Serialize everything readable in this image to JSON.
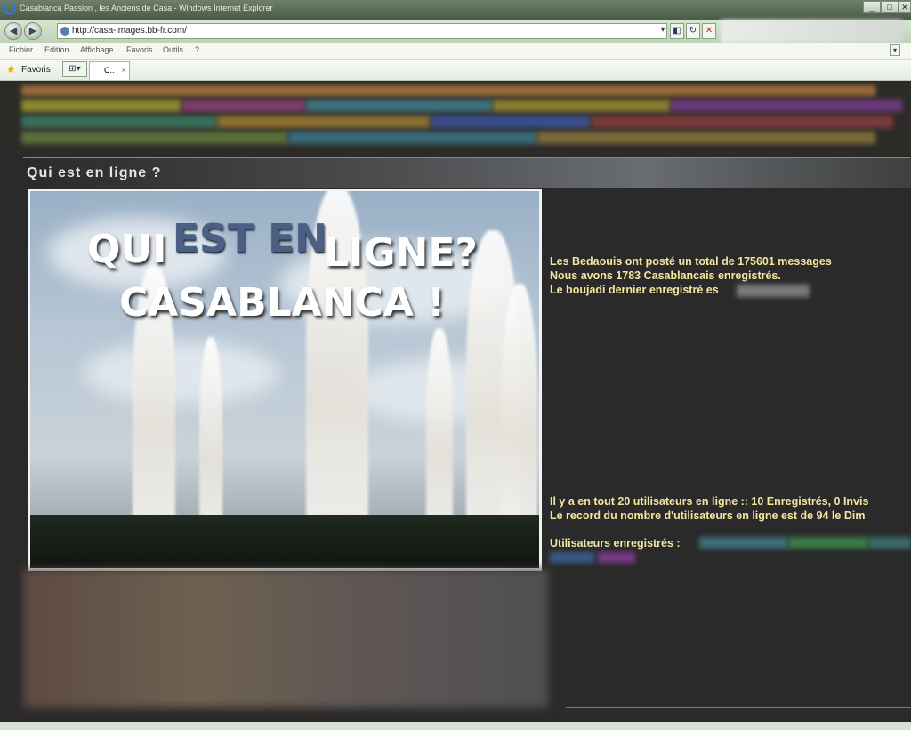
{
  "window": {
    "title": "Casablanca Passion , les Anciens de Casa - Windows Internet Explorer",
    "buttons": [
      "_",
      "□",
      "✕"
    ]
  },
  "address_bar": {
    "url": "http://casa-images.bb-fr.com/",
    "back_icon": "back-arrow-icon",
    "forward_icon": "forward-arrow-icon"
  },
  "menu": [
    "Fichier",
    "Edition",
    "Affichage",
    "Favoris",
    "Outils",
    "?"
  ],
  "favorites": {
    "label": "Favoris",
    "tab_label": "C..",
    "tab_close": "×"
  },
  "panel": {
    "title": "Qui est en ligne ?"
  },
  "image_text": {
    "line1_a": "QUI",
    "line1_b": "EST EN",
    "line1_c": "LIGNE?",
    "line2": "CASABLANCA !"
  },
  "stats": {
    "line1": "Les Bedaouis ont posté un total de 175601 messages",
    "line2": "Nous avons 1783 Casablancais enregistrés.",
    "line3": "Le boujadi dernier enregistré es",
    "online1": "Il y a en tout 20 utilisateurs en ligne :: 10 Enregistrés, 0 Invis",
    "online2": "Le record du nombre d'utilisateurs en ligne est de 94 le Dim",
    "registered": "Utilisateurs enregistrés :"
  },
  "colors": {
    "stat_text": "#f3e6a0",
    "background": "#2a2a2a"
  }
}
